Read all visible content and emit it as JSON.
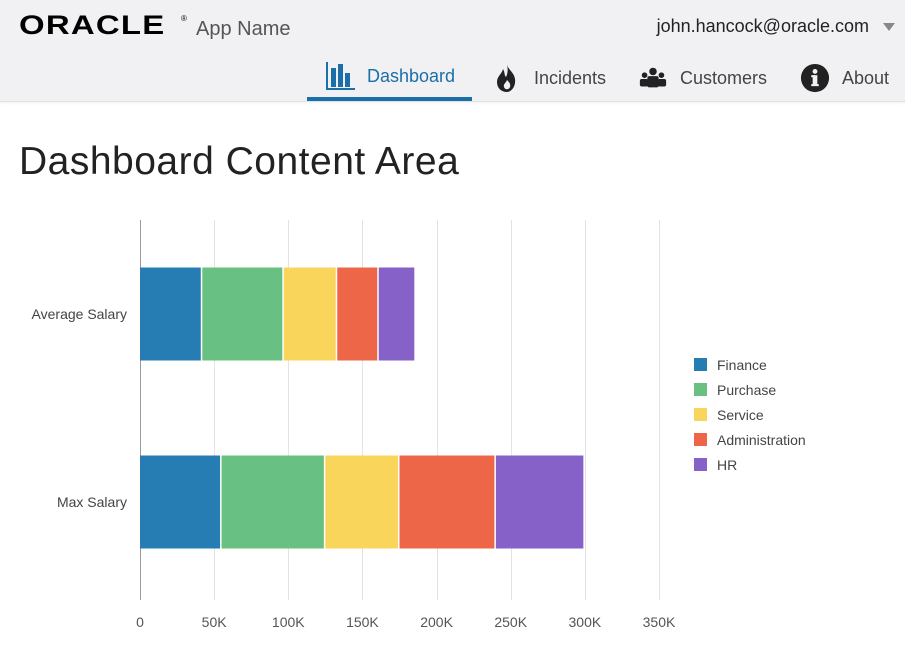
{
  "header": {
    "brand": "ORACLE",
    "app_name": "App Name",
    "user_email": "john.hancock@oracle.com"
  },
  "nav": {
    "items": [
      {
        "label": "Dashboard",
        "icon": "bar-chart-icon",
        "active": true
      },
      {
        "label": "Incidents",
        "icon": "fire-icon",
        "active": false
      },
      {
        "label": "Customers",
        "icon": "people-icon",
        "active": false
      },
      {
        "label": "About",
        "icon": "info-icon",
        "active": false
      }
    ]
  },
  "page": {
    "title": "Dashboard Content Area"
  },
  "colors": {
    "accent": "#1a6fa8",
    "Finance": "#267db3",
    "Purchase": "#68c182",
    "Service": "#fad55c",
    "Administration": "#ed6647",
    "HR": "#8561c8"
  },
  "chart_data": {
    "type": "bar",
    "orientation": "horizontal",
    "stacked": true,
    "categories": [
      "Average Salary",
      "Max Salary"
    ],
    "series": [
      {
        "name": "Finance",
        "values": [
          42000,
          55000
        ]
      },
      {
        "name": "Purchase",
        "values": [
          55000,
          70000
        ]
      },
      {
        "name": "Service",
        "values": [
          36000,
          50000
        ]
      },
      {
        "name": "Administration",
        "values": [
          28000,
          65000
        ]
      },
      {
        "name": "HR",
        "values": [
          25000,
          60000
        ]
      }
    ],
    "xlim": [
      0,
      350000
    ],
    "x_ticks": [
      0,
      50000,
      100000,
      150000,
      200000,
      250000,
      300000,
      350000
    ],
    "x_tick_labels": [
      "0",
      "50K",
      "100K",
      "150K",
      "200K",
      "250K",
      "300K",
      "350K"
    ],
    "grid": true,
    "legend_position": "right",
    "title": "",
    "xlabel": "",
    "ylabel": ""
  }
}
